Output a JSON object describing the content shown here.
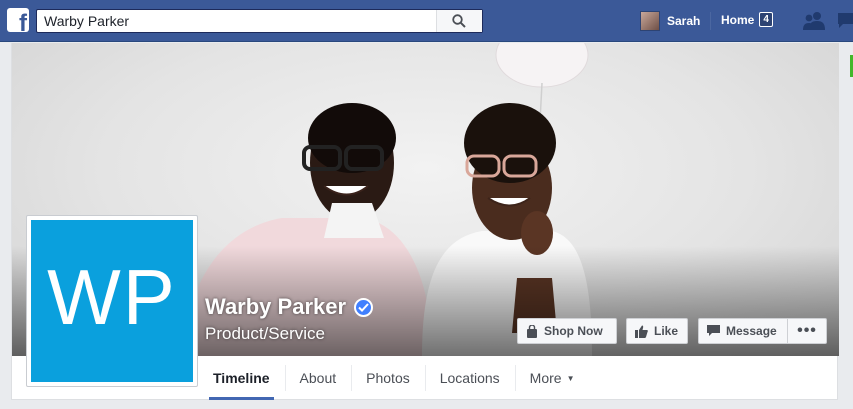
{
  "topbar": {
    "search_value": "Warby Parker",
    "user_name": "Sarah",
    "home_label": "Home",
    "home_badge": "4"
  },
  "page": {
    "profile_initials": "WP",
    "name": "Warby Parker",
    "category": "Product/Service",
    "verified": true
  },
  "actions": {
    "shop_now": "Shop Now",
    "like": "Like",
    "message": "Message",
    "more": "•••"
  },
  "tabs": [
    {
      "label": "Timeline",
      "active": true
    },
    {
      "label": "About"
    },
    {
      "label": "Photos"
    },
    {
      "label": "Locations"
    },
    {
      "label": "More"
    }
  ],
  "colors": {
    "facebook_blue": "#3b5998",
    "brand_tile": "#0aa0dd",
    "verified": "#4080ff"
  }
}
